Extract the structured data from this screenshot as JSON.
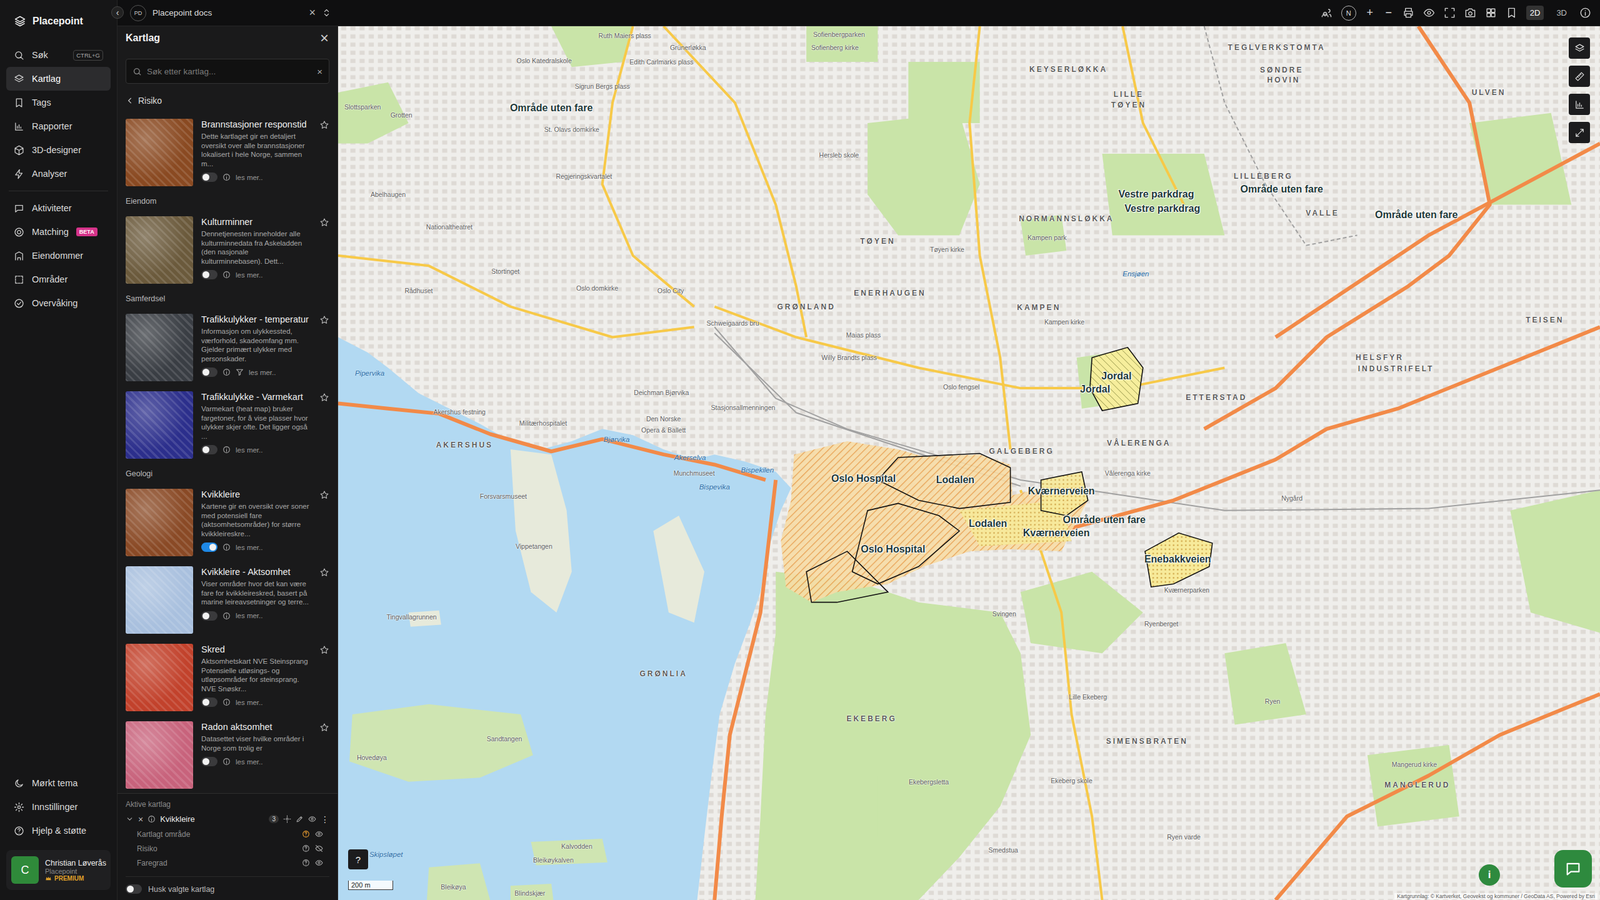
{
  "app": {
    "name": "Placepoint"
  },
  "nav": {
    "items": [
      {
        "label": "Søk",
        "shortcut": "CTRL+G",
        "selected": false
      },
      {
        "label": "Kartlag",
        "shortcut": "",
        "selected": true
      },
      {
        "label": "Tags",
        "shortcut": "",
        "selected": false
      },
      {
        "label": "Rapporter",
        "shortcut": "",
        "selected": false
      },
      {
        "label": "3D-designer",
        "shortcut": "",
        "selected": false
      },
      {
        "label": "Analyser",
        "shortcut": "",
        "selected": false
      }
    ],
    "secondary": [
      {
        "label": "Aktiviteter",
        "badge": "",
        "selected": false
      },
      {
        "label": "Matching",
        "badge": "BETA",
        "selected": false
      },
      {
        "label": "Eiendommer",
        "badge": "",
        "selected": false
      },
      {
        "label": "Områder",
        "badge": "",
        "selected": false
      },
      {
        "label": "Overvåking",
        "badge": "",
        "selected": false
      }
    ],
    "bottom": [
      {
        "label": "Mørkt tema",
        "selected": false
      },
      {
        "label": "Innstillinger",
        "selected": false
      },
      {
        "label": "Hjelp & støtte",
        "selected": false
      }
    ]
  },
  "user": {
    "initial": "C",
    "name": "Christian Løverås",
    "org": "Placepoint",
    "plan": "PREMIUM"
  },
  "topbar": {
    "collapse": "‹",
    "tab": {
      "badge": "PD",
      "title": "Placepoint docs",
      "close": "×"
    },
    "compass": "N",
    "zoom_in": "+",
    "zoom_out": "−",
    "view_modes": [
      {
        "label": "2D",
        "selected": true
      },
      {
        "label": "3D",
        "selected": false
      }
    ]
  },
  "panel": {
    "title": "Kartlag",
    "close": "×",
    "search": {
      "placeholder": "Søk etter kartlag...",
      "clear": "×"
    },
    "breadcrumb": "Risiko",
    "items": [
      {
        "kind": "layer",
        "title": "Brannstasjoner responstid",
        "description": "Dette kartlaget gir en detaljert oversikt over alle brannstasjoner lokalisert i hele Norge, sammen m...",
        "on": false,
        "filter": false,
        "more": "les mer..",
        "color": "#8a4a22"
      },
      {
        "kind": "group",
        "title": "Eiendom"
      },
      {
        "kind": "layer",
        "title": "Kulturminner",
        "description": "Dennetjenesten inneholder alle kulturminnedata fra Askeladden (den nasjonale kulturminnebasen). Dett...",
        "on": false,
        "filter": false,
        "more": "les mer..",
        "color": "#6b5a3c"
      },
      {
        "kind": "group",
        "title": "Samferdsel"
      },
      {
        "kind": "layer",
        "title": "Trafikkulykker - temperatur",
        "description": "Informasjon om ulykkessted, værforhold, skadeomfang mm. Gjelder primært ulykker med personskader.",
        "on": false,
        "filter": true,
        "more": "les mer..",
        "color": "#3a3e44"
      },
      {
        "kind": "layer",
        "title": "Trafikkulykke - Varmekart",
        "description": "Varmekart (heat map) bruker fargetoner, for å vise plasser hvor ulykker skjer ofte. Det ligger også ...",
        "on": false,
        "filter": false,
        "more": "les mer..",
        "color": "#2c2f8c"
      },
      {
        "kind": "group",
        "title": "Geologi"
      },
      {
        "kind": "layer",
        "title": "Kvikkleire",
        "description": "Kartene gir en oversikt over soner med potensiell fare (aktsomhetsområder) for større kvikkleireskre...",
        "on": true,
        "filter": false,
        "more": "les mer..",
        "color": "#8a4a26"
      },
      {
        "kind": "layer",
        "title": "Kvikkleire - Aktsomhet",
        "description": "Viser områder hvor det kan være fare for kvikkleireskred, basert på marine leireavsetninger og terre...",
        "on": false,
        "filter": false,
        "more": "les mer..",
        "color": "#a9c0de"
      },
      {
        "kind": "layer",
        "title": "Skred",
        "description": "Aktsomhetskart NVE Steinsprang Potensielle utløsings- og utløpsområder for steinsprang. NVE Snøskr...",
        "on": false,
        "filter": false,
        "more": "les mer..",
        "color": "#c2422c"
      },
      {
        "kind": "layer",
        "title": "Radon aktsomhet",
        "description": "Datasettet viser hvilke områder i Norge som trolig er",
        "on": false,
        "filter": false,
        "more": "les mer..",
        "color": "#c8637c"
      }
    ],
    "active": {
      "title": "Aktive kartlag",
      "layer": {
        "name": "Kvikkleire",
        "expanded": true,
        "remove": "×",
        "count": "3",
        "more": "⋮"
      },
      "sublayers": [
        {
          "name": "Kartlagt område",
          "visible": true,
          "flagged": true
        },
        {
          "name": "Risiko",
          "visible": false,
          "flagged": false
        },
        {
          "name": "Faregrad",
          "visible": true,
          "flagged": false
        }
      ]
    },
    "remember": {
      "label": "Husk valgte kartlag",
      "on": false
    }
  },
  "map": {
    "scale": "200 m",
    "help": "?",
    "info": "i",
    "attribution": "Kartgrunnlag: © Kartverket, Geovekst og kommuner / GeoData AS, Powered by Esri",
    "labels": [
      {
        "text": "Område uten fare",
        "kind": "area"
      },
      {
        "text": "Vestre parkdrag",
        "kind": "area"
      },
      {
        "text": "Vestre parkdrag",
        "kind": "area"
      },
      {
        "text": "Område uten fare",
        "kind": "area"
      },
      {
        "text": "Område uten fare",
        "kind": "area"
      },
      {
        "text": "Jordal",
        "kind": "area"
      },
      {
        "text": "Jordal",
        "kind": "area"
      },
      {
        "text": "Oslo Hospital",
        "kind": "area"
      },
      {
        "text": "Lodalen",
        "kind": "area"
      },
      {
        "text": "Kværnerveien",
        "kind": "area"
      },
      {
        "text": "Lodalen",
        "kind": "area"
      },
      {
        "text": "Område uten fare",
        "kind": "area"
      },
      {
        "text": "Kværnerveien",
        "kind": "area"
      },
      {
        "text": "Oslo Hospital",
        "kind": "area"
      },
      {
        "text": "Enebakkveien",
        "kind": "area"
      },
      {
        "text": "KEYSERLØKKA",
        "kind": "district"
      },
      {
        "text": "TEGLVERKSTOMTA",
        "kind": "district"
      },
      {
        "text": "SØNDRE",
        "kind": "district"
      },
      {
        "text": "HOVIN",
        "kind": "district"
      },
      {
        "text": "ULVEN",
        "kind": "district"
      },
      {
        "text": "LILLE",
        "kind": "district"
      },
      {
        "text": "TØYEN",
        "kind": "district"
      },
      {
        "text": "LILLEBERG",
        "kind": "district"
      },
      {
        "text": "NORMANNSLØKKA",
        "kind": "district"
      },
      {
        "text": "VALLE",
        "kind": "district"
      },
      {
        "text": "TØYEN",
        "kind": "district"
      },
      {
        "text": "ENERHAUGEN",
        "kind": "district"
      },
      {
        "text": "GRØNLAND",
        "kind": "district"
      },
      {
        "text": "KAMPEN",
        "kind": "district"
      },
      {
        "text": "TEISEN",
        "kind": "district"
      },
      {
        "text": "HELSFYR",
        "kind": "district"
      },
      {
        "text": "INDUSTRIFELT",
        "kind": "district"
      },
      {
        "text": "ETTERSTAD",
        "kind": "district"
      },
      {
        "text": "VÅLERENGA",
        "kind": "district"
      },
      {
        "text": "GALGEBERG",
        "kind": "district"
      },
      {
        "text": "AKERSHUS",
        "kind": "district"
      },
      {
        "text": "GRØNLIA",
        "kind": "district"
      },
      {
        "text": "EKEBERG",
        "kind": "district"
      },
      {
        "text": "SIMENSBRATEN",
        "kind": "district"
      },
      {
        "text": "MANGLERUD",
        "kind": "district"
      },
      {
        "text": "Pipervika",
        "kind": "water"
      },
      {
        "text": "Akerselva",
        "kind": "water"
      },
      {
        "text": "Bjørvika",
        "kind": "water"
      },
      {
        "text": "Bispevika",
        "kind": "water"
      },
      {
        "text": "Bispekilen",
        "kind": "water"
      },
      {
        "text": "Skipsløpet",
        "kind": "water"
      },
      {
        "text": "Ensjøen",
        "kind": "water"
      },
      {
        "text": "Ruth Maiers plass",
        "kind": "place"
      },
      {
        "text": "Grünerløkka",
        "kind": "place"
      },
      {
        "text": "Sofienbergparken",
        "kind": "place"
      },
      {
        "text": "Sofienberg kirke",
        "kind": "place"
      },
      {
        "text": "Oslo Katedralskole",
        "kind": "place"
      },
      {
        "text": "Edith Carlmarks plass",
        "kind": "place"
      },
      {
        "text": "Sigrun Bergs plass",
        "kind": "place"
      },
      {
        "text": "Slottsparken",
        "kind": "place"
      },
      {
        "text": "Grotten",
        "kind": "place"
      },
      {
        "text": "St. Olavs domkirke",
        "kind": "place"
      },
      {
        "text": "Hersleb skole",
        "kind": "place"
      },
      {
        "text": "Abelhaugen",
        "kind": "place"
      },
      {
        "text": "Regjeringskvartalet",
        "kind": "place"
      },
      {
        "text": "Nationaltheatret",
        "kind": "place"
      },
      {
        "text": "Stortinget",
        "kind": "place"
      },
      {
        "text": "Oslo domkirke",
        "kind": "place"
      },
      {
        "text": "Oslo City",
        "kind": "place"
      },
      {
        "text": "Rådhuset",
        "kind": "place"
      },
      {
        "text": "Tøyen kirke",
        "kind": "place"
      },
      {
        "text": "Kampen park",
        "kind": "place"
      },
      {
        "text": "Schweigaards bru",
        "kind": "place"
      },
      {
        "text": "Kampen kirke",
        "kind": "place"
      },
      {
        "text": "Maias plass",
        "kind": "place"
      },
      {
        "text": "Willy Brandts plass",
        "kind": "place"
      },
      {
        "text": "Oslo fengsel",
        "kind": "place"
      },
      {
        "text": "Deichman Bjørvika",
        "kind": "place"
      },
      {
        "text": "Stasjonsallmenningen",
        "kind": "place"
      },
      {
        "text": "Akershus festning",
        "kind": "place"
      },
      {
        "text": "Den Norske",
        "kind": "place"
      },
      {
        "text": "Opera & Ballett",
        "kind": "place"
      },
      {
        "text": "Militærhospitalet",
        "kind": "place"
      },
      {
        "text": "Munchmuseet",
        "kind": "place"
      },
      {
        "text": "Forsvarsmuseet",
        "kind": "place"
      },
      {
        "text": "Vålerenga kirke",
        "kind": "place"
      },
      {
        "text": "Nygård",
        "kind": "place"
      },
      {
        "text": "Vippetangen",
        "kind": "place"
      },
      {
        "text": "Kværnerparken",
        "kind": "place"
      },
      {
        "text": "Svingen",
        "kind": "place"
      },
      {
        "text": "Tingvallagrunnen",
        "kind": "place"
      },
      {
        "text": "Ryenberget",
        "kind": "place"
      },
      {
        "text": "Lille Ekeberg",
        "kind": "place"
      },
      {
        "text": "Ryen",
        "kind": "place"
      },
      {
        "text": "Sandtangen",
        "kind": "place"
      },
      {
        "text": "Hovedøya",
        "kind": "place"
      },
      {
        "text": "Ekebergsletta",
        "kind": "place"
      },
      {
        "text": "Ekeberg skole",
        "kind": "place"
      },
      {
        "text": "Mangerud kirke",
        "kind": "place"
      },
      {
        "text": "Ryen varde",
        "kind": "place"
      },
      {
        "text": "Smedstua",
        "kind": "place"
      },
      {
        "text": "Kalvodden",
        "kind": "place"
      },
      {
        "text": "Bleikøykalven",
        "kind": "place"
      },
      {
        "text": "Bleikøya",
        "kind": "place"
      },
      {
        "text": "Blindskjær",
        "kind": "place"
      }
    ]
  }
}
